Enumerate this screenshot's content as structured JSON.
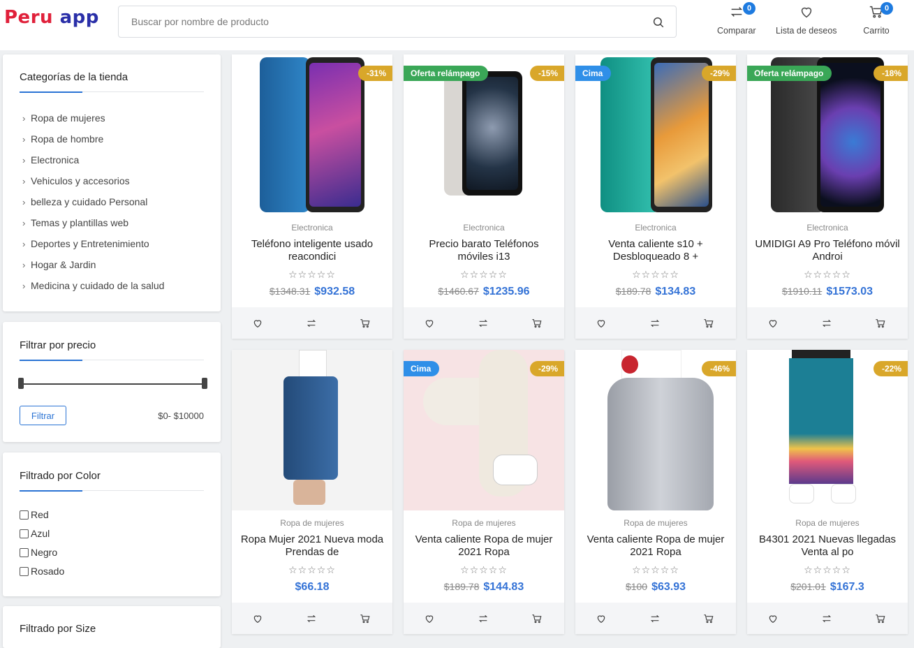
{
  "header": {
    "logo_part1": "Peru",
    "logo_part2": "app",
    "search_placeholder": "Buscar por nombre de producto",
    "compare": {
      "label": "Comparar",
      "count": "0"
    },
    "wishlist": {
      "label": "Lista de deseos"
    },
    "cart": {
      "label": "Carrito",
      "count": "0"
    }
  },
  "sidebar": {
    "categories_title": "Categorías de la tienda",
    "categories": [
      "Ropa de mujeres",
      "Ropa de hombre",
      "Electronica",
      "Vehiculos y accesorios",
      "belleza y cuidado Personal",
      "Temas y plantillas web",
      "Deportes y Entretenimiento",
      "Hogar & Jardin",
      "Medicina y cuidado de la salud"
    ],
    "price_title": "Filtrar por precio",
    "filter_button": "Filtrar",
    "price_range": "$0- $10000",
    "color_title": "Filtrado por Color",
    "colors": [
      "Red",
      "Azul",
      "Negro",
      "Rosado"
    ],
    "size_title": "Filtrado por Size"
  },
  "products": [
    {
      "category": "Electronica",
      "title": "Teléfono inteligente usado reacondici",
      "discount": "-31%",
      "tag": "",
      "old_price": "$1348.31",
      "price": "$932.58"
    },
    {
      "category": "Electronica",
      "title": "Precio barato Teléfonos móviles i13",
      "discount": "-15%",
      "tag": "Oferta relámpago",
      "old_price": "$1460.67",
      "price": "$1235.96"
    },
    {
      "category": "Electronica",
      "title": "Venta caliente s10 + Desbloqueado 8 +",
      "discount": "-29%",
      "tag": "Cima",
      "old_price": "$189.78",
      "price": "$134.83"
    },
    {
      "category": "Electronica",
      "title": "UMIDIGI A9 Pro Teléfono móvil Androi",
      "discount": "-18%",
      "tag": "Oferta relámpago",
      "old_price": "$1910.11",
      "price": "$1573.03"
    },
    {
      "category": "Ropa de mujeres",
      "title": "Ropa Mujer 2021 Nueva moda Prendas de",
      "discount": "",
      "tag": "",
      "old_price": "",
      "price": "$66.18"
    },
    {
      "category": "Ropa de mujeres",
      "title": "Venta caliente Ropa de mujer 2021 Ropa",
      "discount": "-29%",
      "tag": "Cima",
      "old_price": "$189.78",
      "price": "$144.83"
    },
    {
      "category": "Ropa de mujeres",
      "title": "Venta caliente Ropa de mujer 2021 Ropa",
      "discount": "-46%",
      "tag": "",
      "old_price": "$100",
      "price": "$63.93"
    },
    {
      "category": "Ropa de mujeres",
      "title": "B4301 2021 Nuevas llegadas Venta al po",
      "discount": "-22%",
      "tag": "",
      "old_price": "$201.01",
      "price": "$167.3"
    }
  ],
  "stars_display": "☆☆☆☆☆",
  "colors": {
    "accent": "#2a73d4",
    "price": "#3372d6",
    "discount": "#d9a72a",
    "tag_flash": "#3aa757",
    "tag_top": "#2f8fe8",
    "logo_red": "#e0203a",
    "logo_blue": "#2a2fa8"
  }
}
